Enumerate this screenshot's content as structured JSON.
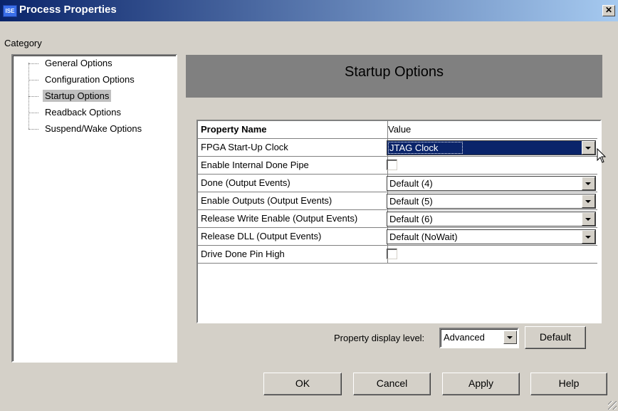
{
  "window": {
    "title": "Process Properties",
    "app_icon_text": "ISE",
    "close_glyph": "✕"
  },
  "category": {
    "label": "Category",
    "items": [
      {
        "label": "General Options",
        "selected": false
      },
      {
        "label": "Configuration Options",
        "selected": false
      },
      {
        "label": "Startup Options",
        "selected": true
      },
      {
        "label": "Readback Options",
        "selected": false
      },
      {
        "label": "Suspend/Wake Options",
        "selected": false
      }
    ]
  },
  "panel": {
    "title": "Startup Options"
  },
  "grid": {
    "header": {
      "name": "Property Name",
      "value": "Value"
    },
    "rows": [
      {
        "name": "FPGA Start-Up Clock",
        "type": "dropdown",
        "value": "JTAG Clock",
        "selected": true
      },
      {
        "name": "Enable Internal Done Pipe",
        "type": "checkbox",
        "checked": false
      },
      {
        "name": "Done (Output Events)",
        "type": "dropdown",
        "value": "Default (4)"
      },
      {
        "name": "Enable Outputs (Output Events)",
        "type": "dropdown",
        "value": "Default (5)"
      },
      {
        "name": "Release Write Enable (Output Events)",
        "type": "dropdown",
        "value": "Default (6)"
      },
      {
        "name": "Release DLL (Output Events)",
        "type": "dropdown",
        "value": "Default (NoWait)"
      },
      {
        "name": "Drive Done Pin High",
        "type": "checkbox",
        "checked": false
      }
    ]
  },
  "display_level": {
    "label": "Property display level:",
    "value": "Advanced",
    "default_button": "Default"
  },
  "buttons": {
    "ok": "OK",
    "cancel": "Cancel",
    "apply": "Apply",
    "help": "Help"
  },
  "colors": {
    "face": "#d4d0c8",
    "title_start": "#0a246a",
    "title_end": "#a6caf0",
    "header_panel": "#808080",
    "selection": "#0a246a"
  }
}
